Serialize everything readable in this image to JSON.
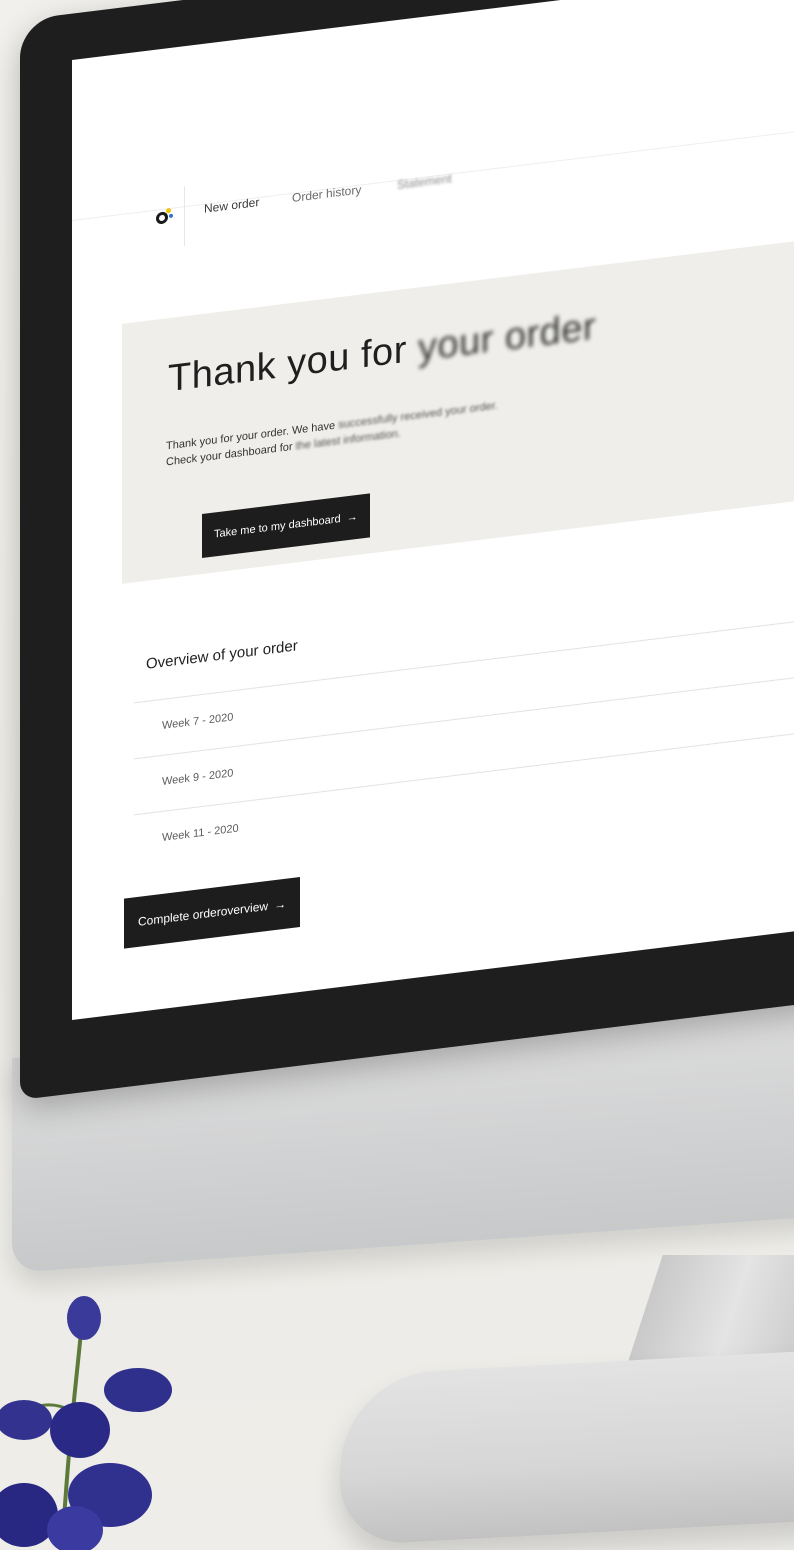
{
  "nav": {
    "items": [
      {
        "label": "New order"
      },
      {
        "label": "Order history"
      },
      {
        "label": "Statement"
      }
    ]
  },
  "hero": {
    "title_start": "Thank you for ",
    "title_end": "your order",
    "text_line1_start": "Thank you for your order. We have ",
    "text_line1_end": "successfully received your order.",
    "text_line2_start": "Check your dashboard for ",
    "text_line2_end": "the latest information.",
    "button_label": "Take me to my dashboard",
    "button_arrow": "→"
  },
  "overview": {
    "title": "Overview of your order",
    "weeks": [
      "Week 7 - 2020",
      "Week 9 - 2020",
      "Week 11 - 2020"
    ],
    "button_label": "Complete orderoverview",
    "button_arrow": "→"
  },
  "colors": {
    "background": "#efeeea",
    "button": "#1d1d1d",
    "bezel": "#1e1e1f",
    "flower": "#2a2a8c"
  }
}
